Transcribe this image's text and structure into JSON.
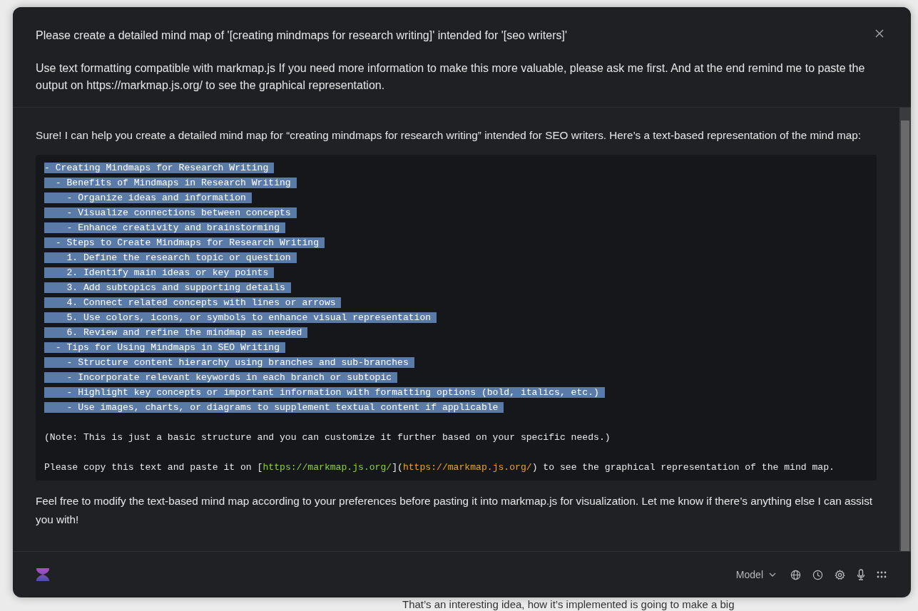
{
  "background_text": "That’s an interesting idea, how it’s implemented is going to make a big",
  "prompt": {
    "paragraphs": [
      "Please create a detailed mind map of '[creating mindmaps for research writing]' intended for '[seo writers]'",
      "Use text formatting compatible with markmap.js If you need more information to make this more valuable, please ask me first. And at the end remind me to paste the output on https://markmap.js.org/ to see the graphical representation."
    ]
  },
  "response": {
    "intro": "Sure! I can help you create a detailed mind map for “creating mindmaps for research writing” intended for SEO writers. Here’s a text-based representation of the mind map:",
    "code_lines": [
      {
        "text": "- Creating Mindmaps for Research Writing",
        "selected": true
      },
      {
        "text": "  - Benefits of Mindmaps in Research Writing",
        "selected": true
      },
      {
        "text": "    - Organize ideas and information",
        "selected": true
      },
      {
        "text": "    - Visualize connections between concepts",
        "selected": true
      },
      {
        "text": "    - Enhance creativity and brainstorming",
        "selected": true
      },
      {
        "text": "  - Steps to Create Mindmaps for Research Writing",
        "selected": true
      },
      {
        "text": "    1. Define the research topic or question",
        "selected": true
      },
      {
        "text": "    2. Identify main ideas or key points",
        "selected": true
      },
      {
        "text": "    3. Add subtopics and supporting details",
        "selected": true
      },
      {
        "text": "    4. Connect related concepts with lines or arrows",
        "selected": true
      },
      {
        "text": "    5. Use colors, icons, or symbols to enhance visual representation",
        "selected": true
      },
      {
        "text": "    6. Review and refine the mindmap as needed",
        "selected": true
      },
      {
        "text": "  - Tips for Using Mindmaps in SEO Writing",
        "selected": true
      },
      {
        "text": "    - Structure content hierarchy using branches and sub-branches",
        "selected": true
      },
      {
        "text": "    - Incorporate relevant keywords in each branch or subtopic",
        "selected": true
      },
      {
        "text": "    - Highlight key concepts or important information with formatting options (bold, italics, etc.)",
        "selected": true
      },
      {
        "text": "    - Use images, charts, or diagrams to supplement textual content if applicable",
        "selected": true
      },
      {
        "text": "(Note: This is just a basic structure and you can customize it further based on your specific needs.)",
        "selected": false
      },
      {
        "parts": [
          {
            "kind": "plain",
            "text": "Please copy this text and paste it on ["
          },
          {
            "kind": "link_text",
            "text": "https://markmap.js.org/"
          },
          {
            "kind": "plain",
            "text": "]("
          },
          {
            "kind": "link_url",
            "text": "https://markmap.js.org/"
          },
          {
            "kind": "plain",
            "text": ") to see the graphical representation of the mind map."
          }
        ],
        "selected": false
      }
    ],
    "outro": "Feel free to modify the text-based mind map according to your preferences before pasting it into markmap.js for visualization. Let me know if there’s anything else I can assist you with!"
  },
  "footer": {
    "model_label": "Model"
  }
}
